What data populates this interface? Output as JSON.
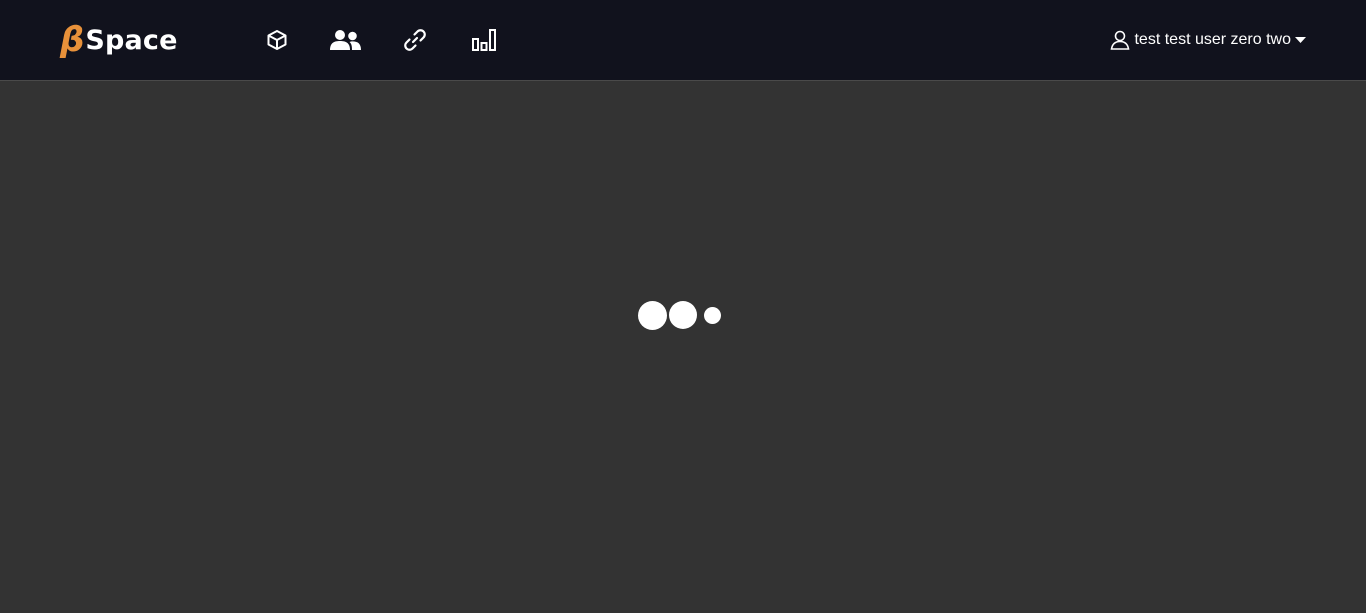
{
  "app": {
    "logo_symbol": "β",
    "logo_text": "Space",
    "brand_color": "#e8913a"
  },
  "nav": {
    "icons": [
      {
        "name": "cube-icon"
      },
      {
        "name": "users-icon"
      },
      {
        "name": "link-icon"
      },
      {
        "name": "bar-chart-icon"
      }
    ]
  },
  "user": {
    "name": "test test user zero two",
    "icon": "user-outline-icon",
    "caret": "caret-down-icon"
  },
  "main": {
    "state": "loading",
    "loader": "loading-dots"
  },
  "colors": {
    "navbar_bg": "#11121d",
    "page_bg": "#333333",
    "text": "#ffffff"
  }
}
